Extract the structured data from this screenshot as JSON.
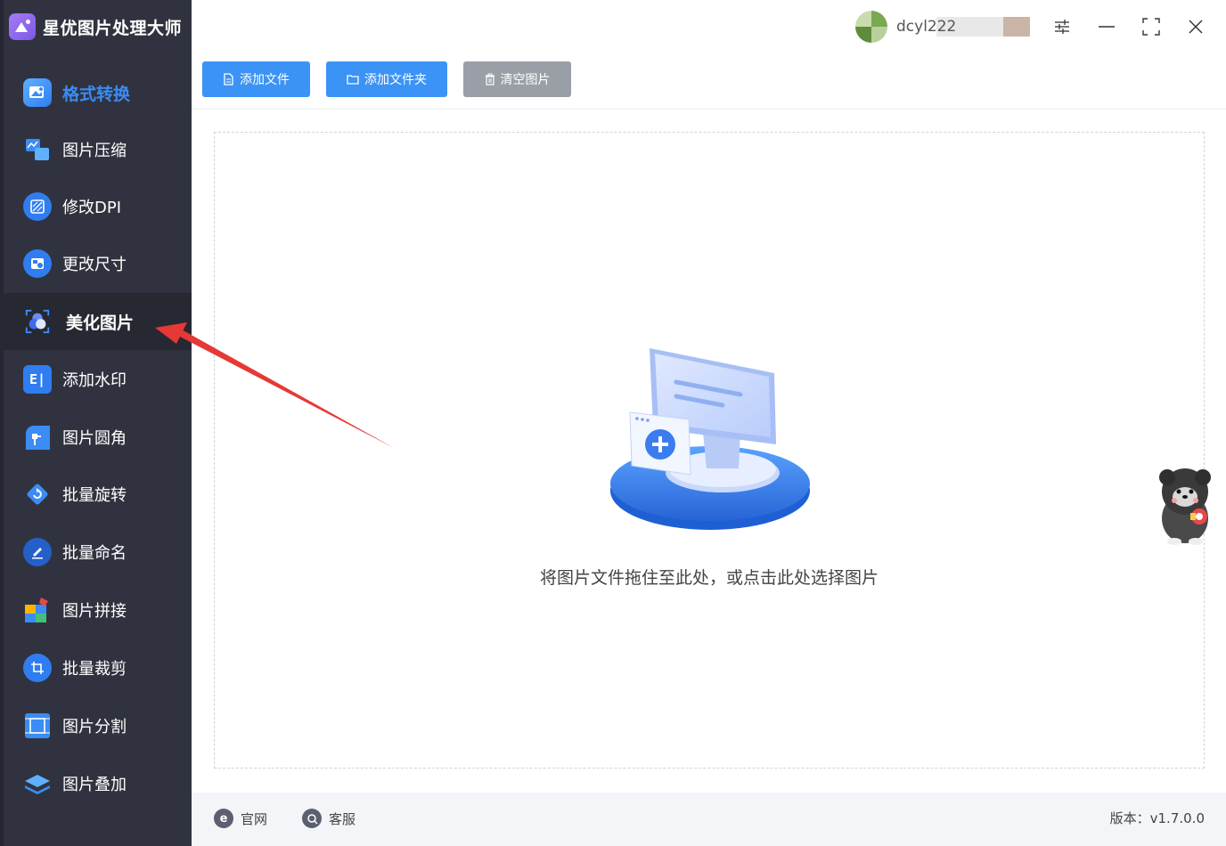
{
  "app": {
    "title": "星优图片处理大师"
  },
  "user": {
    "name": "dcyl222"
  },
  "window_controls": [
    "settings-icon",
    "minimize-icon",
    "maximize-icon",
    "close-icon"
  ],
  "sidebar": {
    "items": [
      {
        "label": "格式转换",
        "icon": "image-convert-icon",
        "state": "current"
      },
      {
        "label": "图片压缩",
        "icon": "compress-icon"
      },
      {
        "label": "修改DPI",
        "icon": "dpi-icon"
      },
      {
        "label": "更改尺寸",
        "icon": "resize-icon"
      },
      {
        "label": "美化图片",
        "icon": "beautify-icon",
        "state": "highlighted"
      },
      {
        "label": "添加水印",
        "icon": "watermark-icon"
      },
      {
        "label": "图片圆角",
        "icon": "rounded-corner-icon"
      },
      {
        "label": "批量旋转",
        "icon": "rotate-icon"
      },
      {
        "label": "批量命名",
        "icon": "rename-icon"
      },
      {
        "label": "图片拼接",
        "icon": "stitch-icon"
      },
      {
        "label": "批量裁剪",
        "icon": "crop-icon"
      },
      {
        "label": "图片分割",
        "icon": "split-icon"
      },
      {
        "label": "图片叠加",
        "icon": "layers-icon"
      }
    ]
  },
  "toolbar": {
    "add_file": "添加文件",
    "add_folder": "添加文件夹",
    "clear_images": "清空图片"
  },
  "dropzone": {
    "text": "将图片文件拖住至此处，或点击此处选择图片"
  },
  "footer": {
    "website": "官网",
    "support": "客服",
    "version": "版本：v1.7.0.0"
  },
  "colors": {
    "accent": "#3b93f5",
    "sidebar_bg": "#30333f",
    "annotation_arrow": "#e53935"
  }
}
